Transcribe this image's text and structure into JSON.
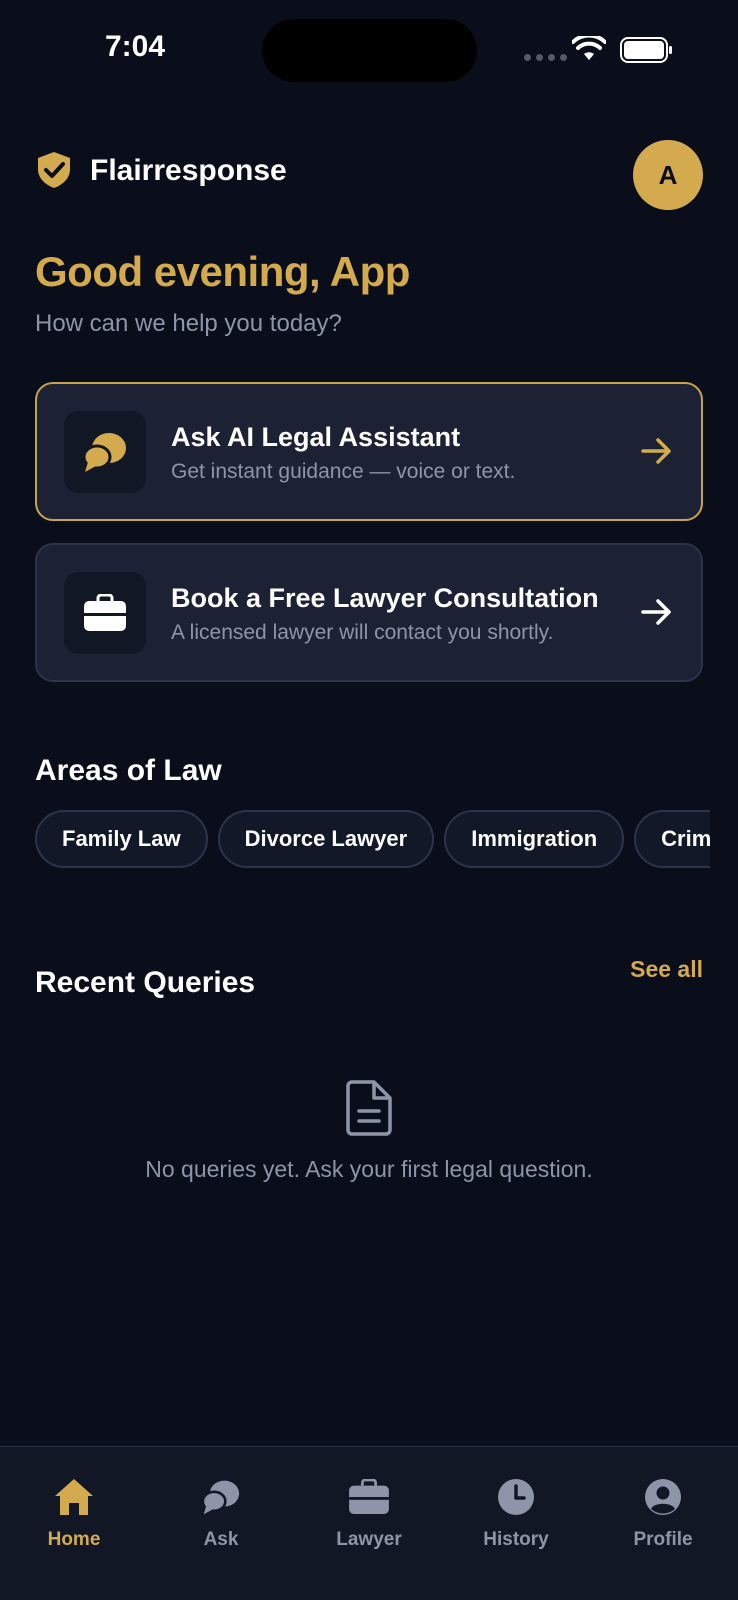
{
  "status_bar": {
    "time": "7:04"
  },
  "header": {
    "brand": "Flairresponse",
    "avatar_initial": "A"
  },
  "greeting": {
    "title": "Good evening, App",
    "subtitle": "How can we help you today?"
  },
  "cards": [
    {
      "title": "Ask AI Legal Assistant",
      "subtitle": "Get instant guidance — voice or text.",
      "icon": "chat-bubbles-icon"
    },
    {
      "title": "Book a Free Lawyer Consultation",
      "subtitle": "A licensed lawyer will contact you shortly.",
      "icon": "briefcase-icon"
    }
  ],
  "areas": {
    "title": "Areas of Law",
    "chips": [
      "Family Law",
      "Divorce Lawyer",
      "Immigration",
      "Criminal Law"
    ]
  },
  "recent": {
    "title": "Recent Queries",
    "see_all": "See all",
    "empty_text": "No queries yet. Ask your first legal question."
  },
  "tabs": [
    {
      "label": "Home",
      "icon": "home-icon",
      "active": true
    },
    {
      "label": "Ask",
      "icon": "chat-bubbles-icon",
      "active": false
    },
    {
      "label": "Lawyer",
      "icon": "briefcase-icon",
      "active": false
    },
    {
      "label": "History",
      "icon": "clock-icon",
      "active": false
    },
    {
      "label": "Profile",
      "icon": "person-icon",
      "active": false
    }
  ],
  "colors": {
    "accent": "#d4aa4e",
    "background": "#0a0e1a",
    "card": "#1c2233",
    "muted": "#8e95a8"
  }
}
